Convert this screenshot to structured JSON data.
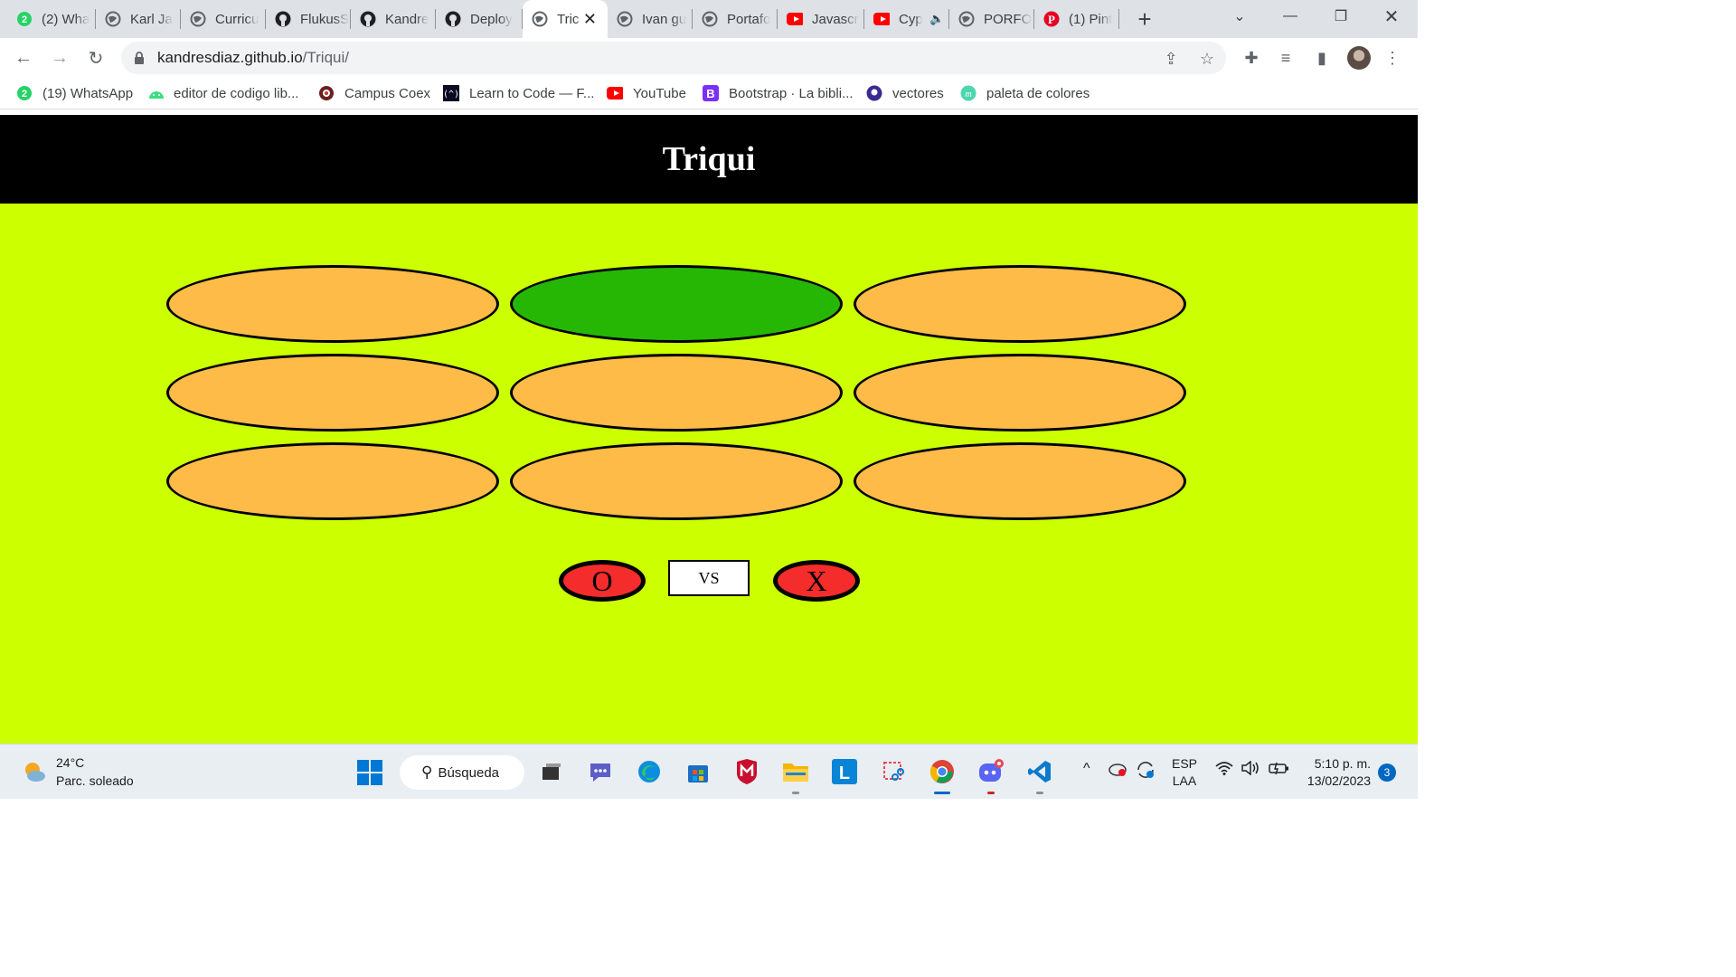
{
  "browser": {
    "tabs": [
      {
        "title": "(2) Wha",
        "icon": "whatsapp-icon",
        "color": "#25d366"
      },
      {
        "title": "Karl Ja",
        "icon": "globe-icon",
        "color": "#5f6368"
      },
      {
        "title": "Curricu",
        "icon": "globe-icon",
        "color": "#5f6368"
      },
      {
        "title": "FlukusS",
        "icon": "github-icon",
        "color": "#202124"
      },
      {
        "title": "Kandre",
        "icon": "github-icon",
        "color": "#202124"
      },
      {
        "title": "Deploy",
        "icon": "github-icon",
        "color": "#202124"
      },
      {
        "title": "Tric",
        "icon": "globe-icon",
        "color": "#5f6368",
        "active": true
      },
      {
        "title": "Ivan gu",
        "icon": "globe-icon",
        "color": "#5f6368"
      },
      {
        "title": "Portafo",
        "icon": "globe-icon",
        "color": "#5f6368"
      },
      {
        "title": "Javascr",
        "icon": "youtube-icon",
        "color": "#ff0000"
      },
      {
        "title": "Cyp",
        "icon": "youtube-icon",
        "color": "#ff0000",
        "audio": true
      },
      {
        "title": "PORFO",
        "icon": "globe-icon",
        "color": "#5f6368"
      },
      {
        "title": "(1) Pint",
        "icon": "pinterest-icon",
        "color": "#e60023"
      }
    ],
    "url_host": "kandresdiaz.github.io",
    "url_path": "/Triqui/",
    "bookmarks": [
      {
        "label": "(19) WhatsApp",
        "icon": "whatsapp-icon"
      },
      {
        "label": "editor de codigo lib...",
        "icon": "android-icon"
      },
      {
        "label": "Campus Coex",
        "icon": "campus-coex-icon"
      },
      {
        "label": "Learn to Code — F...",
        "icon": "freecodecamp-icon"
      },
      {
        "label": "YouTube",
        "icon": "youtube-icon"
      },
      {
        "label": "Bootstrap · La bibli...",
        "icon": "bootstrap-icon"
      },
      {
        "label": "vectores",
        "icon": "vectores-icon"
      },
      {
        "label": "paleta de colores",
        "icon": "palette-icon"
      }
    ]
  },
  "game": {
    "title": "Triqui",
    "board": [
      {
        "value": "",
        "state": "empty"
      },
      {
        "value": "",
        "state": "highlighted"
      },
      {
        "value": "",
        "state": "empty"
      },
      {
        "value": "",
        "state": "empty"
      },
      {
        "value": "",
        "state": "empty"
      },
      {
        "value": "",
        "state": "empty"
      },
      {
        "value": "",
        "state": "empty"
      },
      {
        "value": "",
        "state": "empty"
      },
      {
        "value": "",
        "state": "empty"
      }
    ],
    "player_one": "O",
    "vs_label": "VS",
    "player_two": "X",
    "colors": {
      "background": "#ccff00",
      "cell": "#ffbb47",
      "highlight": "#26b705",
      "player": "#f52c2c",
      "header": "#000000"
    }
  },
  "taskbar": {
    "weather_temp": "24°C",
    "weather_desc": "Parc. soleado",
    "search_label": "Búsqueda",
    "lang_top": "ESP",
    "lang_bottom": "LAA",
    "time": "5:10 p. m.",
    "date": "13/02/2023",
    "notifications": "3"
  }
}
